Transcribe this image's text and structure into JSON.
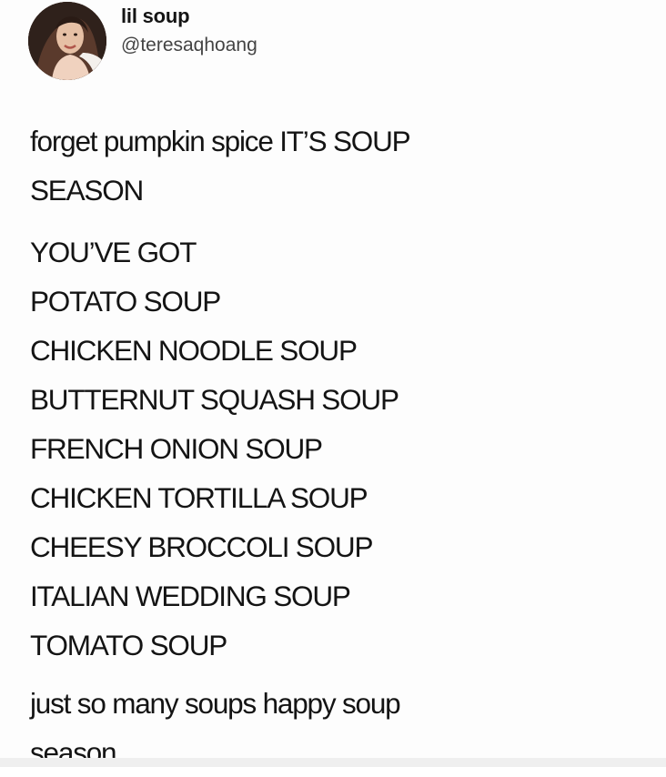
{
  "tweet": {
    "display_name": "lil soup",
    "handle": "@teresaqhoang",
    "intro_lines": [
      "forget pumpkin spice IT’S SOUP",
      "SEASON"
    ],
    "list_lines": [
      "YOU’VE GOT",
      "POTATO SOUP",
      "CHICKEN NOODLE SOUP",
      "BUTTERNUT SQUASH SOUP",
      "FRENCH ONION SOUP",
      "CHICKEN TORTILLA SOUP",
      "CHEESY BROCCOLI SOUP",
      "ITALIAN WEDDING SOUP",
      "TOMATO SOUP"
    ],
    "outro_lines": [
      "just so many soups happy soup",
      "season"
    ]
  }
}
